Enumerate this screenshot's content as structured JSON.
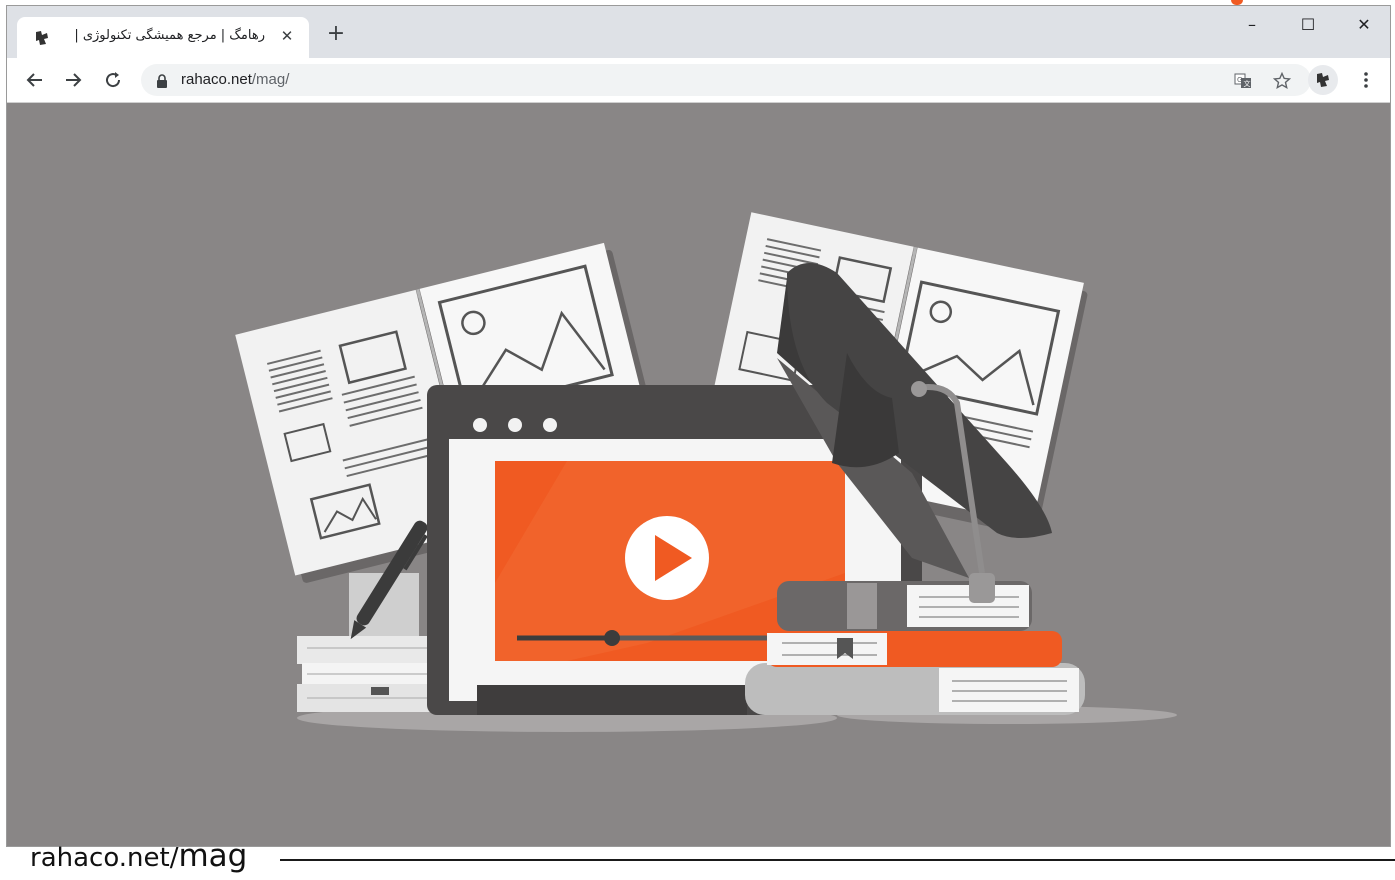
{
  "browser": {
    "tab": {
      "title": "رهامگ | مرجع همیشگی تکنولوژی |",
      "favicon": "rahaco-logo-icon"
    },
    "new_tab_label": "+",
    "window_controls": {
      "minimize": "–",
      "maximize": "☐",
      "close": "✕"
    },
    "address_bar": {
      "domain": "rahaco.net",
      "path": "/mag/"
    },
    "toolbar_icons": [
      "back-icon",
      "forward-icon",
      "reload-icon",
      "lock-icon",
      "translate-icon",
      "star-icon",
      "profile-avatar-icon",
      "more-menu-icon"
    ]
  },
  "caption": {
    "domain": "rahaco.net/",
    "path": "mag"
  },
  "colors": {
    "background": "#898686",
    "accent_orange": "#f05a22",
    "tabstrip": "#dee1e6"
  }
}
